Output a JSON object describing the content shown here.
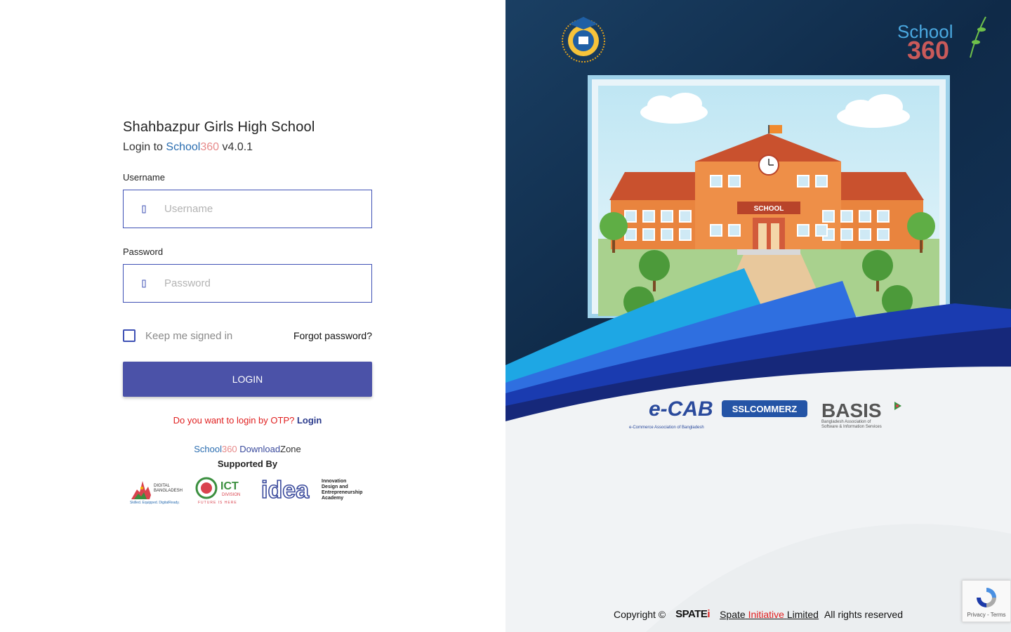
{
  "school": {
    "name": "Shahbazpur Girls High School",
    "login_prefix": "Login to",
    "brand_a": "School",
    "brand_b": "360",
    "version": "v4.0.1"
  },
  "form": {
    "username_label": "Username",
    "username_placeholder": "Username",
    "username_value": "",
    "password_label": "Password",
    "password_placeholder": "Password",
    "password_value": "",
    "keep_signed_in": "Keep me signed in",
    "keep_signed_in_checked": false,
    "forgot": "Forgot password?",
    "login_button": "LOGIN"
  },
  "otp": {
    "question": "Do you want to login by OTP?",
    "link": "Login"
  },
  "download": {
    "brand_a": "School",
    "brand_b": "360",
    "download": "Download",
    "zone": "Zone"
  },
  "supported_by": "Supported By",
  "sponsors": {
    "digital_bd_a": "DIGITAL",
    "digital_bd_b": "BANGLADESH",
    "digital_bd_tag": "Skilled. Equipped. DigitalReady.",
    "ict_a": "ICT",
    "ict_b": "DIVISION",
    "ict_tag": "FUTURE IS HERE",
    "idea_logo": "idea",
    "idea_a": "Innovation",
    "idea_b": "Design and",
    "idea_c": "Entrepreneurship",
    "idea_d": "Academy"
  },
  "right": {
    "school360_a": "School",
    "school360_b": "360",
    "building_sign": "SCHOOL",
    "partners": {
      "ecab": "e-CAB",
      "ecab_sub": "e-Commerce Association of Bangladesh",
      "ssl": "SSLCOMMERZ",
      "basis": "BASIS",
      "basis_sub_a": "Bangladesh Association of",
      "basis_sub_b": "Software & Information Services"
    }
  },
  "footer": {
    "copyright": "Copyright ©",
    "logo_a": "SPATE",
    "logo_b": "i",
    "company_a": "Spate",
    "company_b": "Initiative",
    "company_c": "Limited",
    "rights": "All rights reserved"
  },
  "recaptcha": {
    "links": "Privacy - Terms"
  },
  "colors": {
    "primary": "#3f51b5",
    "button": "#4b52a8",
    "brand_blue": "#2a6db0",
    "brand_pink": "#e78a8a",
    "otp_red": "#e02020",
    "panel_dark": "#123456"
  },
  "icons": {
    "username": "user-icon",
    "password": "lock-icon"
  }
}
